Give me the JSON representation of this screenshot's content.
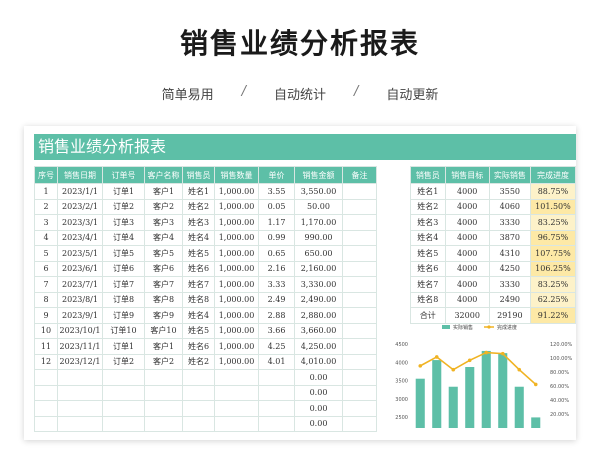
{
  "title": "销售业绩分析报表",
  "subtitle": [
    "简单易用",
    "自动统计",
    "自动更新"
  ],
  "subtitle_sep": "/",
  "sheet_title": "销售业绩分析报表",
  "main_headers": [
    "序号",
    "销售日期",
    "订单号",
    "客户名称",
    "销售员",
    "销售数量",
    "单价",
    "销售金额",
    "备注"
  ],
  "main_rows": [
    [
      "1",
      "2023/1/1",
      "订单1",
      "客户1",
      "姓名1",
      "1,000.00",
      "3.55",
      "3,550.00",
      ""
    ],
    [
      "2",
      "2023/2/1",
      "订单2",
      "客户2",
      "姓名2",
      "1,000.00",
      "0.05",
      "50.00",
      ""
    ],
    [
      "3",
      "2023/3/1",
      "订单3",
      "客户3",
      "姓名3",
      "1,000.00",
      "1.17",
      "1,170.00",
      ""
    ],
    [
      "4",
      "2023/4/1",
      "订单4",
      "客户4",
      "姓名4",
      "1,000.00",
      "0.99",
      "990.00",
      ""
    ],
    [
      "5",
      "2023/5/1",
      "订单5",
      "客户5",
      "姓名5",
      "1,000.00",
      "0.65",
      "650.00",
      ""
    ],
    [
      "6",
      "2023/6/1",
      "订单6",
      "客户6",
      "姓名6",
      "1,000.00",
      "2.16",
      "2,160.00",
      ""
    ],
    [
      "7",
      "2023/7/1",
      "订单7",
      "客户7",
      "姓名7",
      "1,000.00",
      "3.33",
      "3,330.00",
      ""
    ],
    [
      "8",
      "2023/8/1",
      "订单8",
      "客户8",
      "姓名8",
      "1,000.00",
      "2.49",
      "2,490.00",
      ""
    ],
    [
      "9",
      "2023/9/1",
      "订单9",
      "客户9",
      "姓名4",
      "1,000.00",
      "2.88",
      "2,880.00",
      ""
    ],
    [
      "10",
      "2023/10/1",
      "订单10",
      "客户10",
      "姓名5",
      "1,000.00",
      "3.66",
      "3,660.00",
      ""
    ],
    [
      "11",
      "2023/11/1",
      "订单1",
      "客户1",
      "姓名6",
      "1,000.00",
      "4.25",
      "4,250.00",
      ""
    ],
    [
      "12",
      "2023/12/1",
      "订单2",
      "客户2",
      "姓名2",
      "1,000.00",
      "4.01",
      "4,010.00",
      ""
    ],
    [
      "",
      "",
      "",
      "",
      "",
      "",
      "",
      "0.00",
      ""
    ],
    [
      "",
      "",
      "",
      "",
      "",
      "",
      "",
      "0.00",
      ""
    ],
    [
      "",
      "",
      "",
      "",
      "",
      "",
      "",
      "0.00",
      ""
    ],
    [
      "",
      "",
      "",
      "",
      "",
      "",
      "",
      "0.00",
      ""
    ]
  ],
  "side_headers": [
    "销售员",
    "销售目标",
    "实际销售",
    "完成进度"
  ],
  "side_rows": [
    [
      "姓名1",
      "4000",
      "3550",
      "88.75%"
    ],
    [
      "姓名2",
      "4000",
      "4060",
      "101.50%"
    ],
    [
      "姓名3",
      "4000",
      "3330",
      "83.25%"
    ],
    [
      "姓名4",
      "4000",
      "3870",
      "96.75%"
    ],
    [
      "姓名5",
      "4000",
      "4310",
      "107.75%"
    ],
    [
      "姓名6",
      "4000",
      "4250",
      "106.25%"
    ],
    [
      "姓名7",
      "4000",
      "3330",
      "83.25%"
    ],
    [
      "姓名8",
      "4000",
      "2490",
      "62.25%"
    ],
    [
      "合计",
      "32000",
      "29190",
      "91.22%"
    ]
  ],
  "chart_data": {
    "type": "bar",
    "categories": [
      "姓名1",
      "姓名2",
      "姓名3",
      "姓名4",
      "姓名5",
      "姓名6",
      "姓名7",
      "姓名8"
    ],
    "series": [
      {
        "name": "实际销售",
        "type": "bar",
        "axis": "left",
        "values": [
          3550,
          4060,
          3330,
          3870,
          4310,
          4250,
          3330,
          2490
        ]
      },
      {
        "name": "完成进度",
        "type": "line",
        "axis": "right",
        "values": [
          88.75,
          101.5,
          83.25,
          96.75,
          107.75,
          106.25,
          83.25,
          62.25
        ]
      }
    ],
    "y_left": {
      "min": 0,
      "max": 4500,
      "ticks": [
        "4500",
        "4000",
        "3500",
        "3000",
        "2500"
      ]
    },
    "y_right": {
      "min": 0,
      "max": 120,
      "ticks": [
        "120.00%",
        "100.00%",
        "80.00%",
        "60.00%",
        "40.00%",
        "20.00%"
      ]
    },
    "legend_position": "top",
    "colors": {
      "bar": "#5dbfa7",
      "line": "#f0b323"
    }
  }
}
